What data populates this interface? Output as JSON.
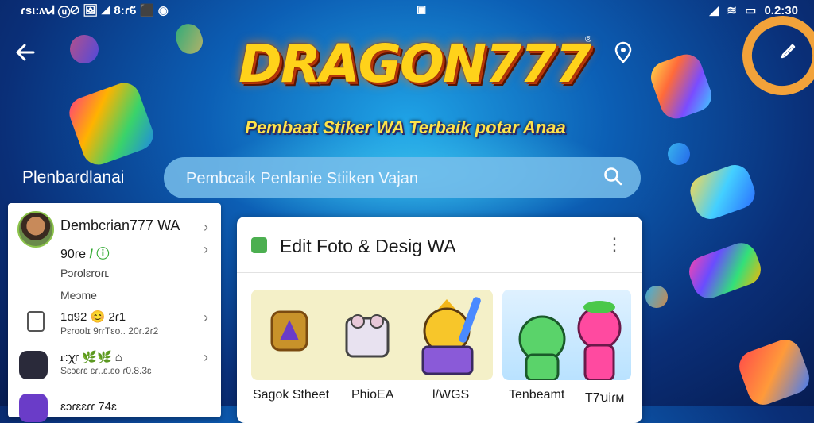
{
  "status_bar": {
    "left_text": "ɾsι:ʍᏗ ⓤ⊘ 🖼 ◢ 8:ɾϐ ⬛ ◉",
    "center_icon": "sim-icon",
    "right_time": "0.2:30"
  },
  "actions": {
    "back_icon": "arrow-left-icon",
    "location_icon": "map-pin-icon",
    "edit_icon": "pencil-icon"
  },
  "brand": {
    "logo_text": "DRAGON777",
    "registered_mark": "®",
    "tagline": "Pembaat Stiker WA Terbaik potar Anaa"
  },
  "header": {
    "page_label": "Plenbardlanai",
    "search_placeholder": "Pembcaik Penlanie Stiiken Vajan"
  },
  "profile_card": {
    "name": "Dembcrian777 WA",
    "stat": "90ɾe",
    "stat_suffix": "/ ⓘ",
    "sub": "Pɔɾolɛroɾʟ",
    "section_label": "Meɔme",
    "rows": [
      {
        "title": "1ɑ92 😊 2ɾ1",
        "meta": "Pɛɾoolɪ  9ɾɾTɛo..  20ɾ.2ɾ2"
      },
      {
        "title": "ꮁ:ꭓɾ 🌿🌿 ⌂",
        "meta": "Sɛɔɛɾɛ  ɛɾ..ɛ.ɛo  ɾ0.8.3ɛ"
      },
      {
        "title": "ɛɔɾɛɛɾɾ 74ɛ",
        "meta": ""
      }
    ]
  },
  "editor_card": {
    "title": "Edit Foto & Desig WA",
    "more_icon": "more-vertical-icon",
    "captions": [
      "Sagok Stheet",
      "PhioEA",
      "l/WGS",
      "Tenbeamt",
      "T7ꭒiɾᴍ"
    ]
  },
  "colors": {
    "accent_green": "#4caf50",
    "logo_gold": "#ffd21a"
  }
}
